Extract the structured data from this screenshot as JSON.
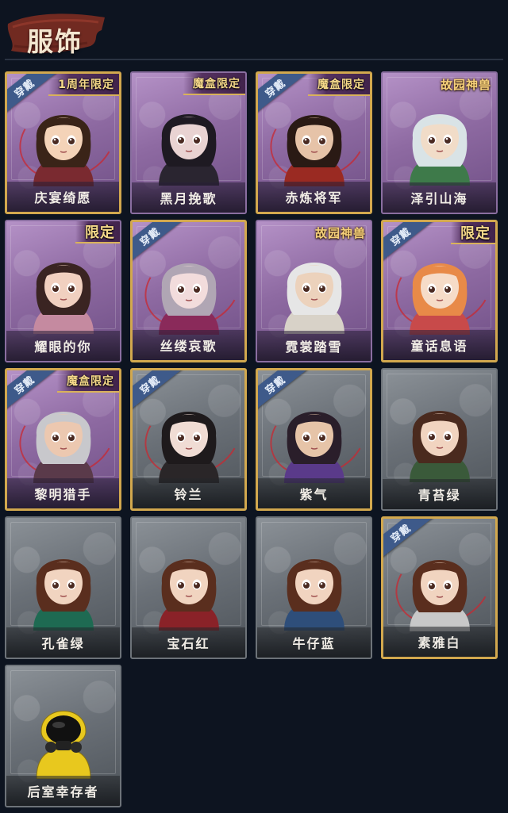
{
  "header": {
    "title": "服饰"
  },
  "worn_label": "穿戴",
  "costumes": [
    {
      "name": "庆宴绮愿",
      "tag": "1周年限定",
      "tag_style": "plain",
      "worn": true,
      "rarity": "rare",
      "hair": "#3a2418",
      "skin": "#f4d3b8",
      "outfit": "#7a2a30"
    },
    {
      "name": "黑月挽歌",
      "tag": "魔盒限定",
      "tag_style": "plain",
      "worn": false,
      "rarity": "rare",
      "hair": "#1e1a22",
      "skin": "#e9d3d2",
      "outfit": "#2a2530"
    },
    {
      "name": "赤炼将军",
      "tag": "魔盒限定",
      "tag_style": "plain",
      "worn": true,
      "rarity": "rare",
      "hair": "#2a1a14",
      "skin": "#e6c3a8",
      "outfit": "#9a2a22"
    },
    {
      "name": "泽引山海",
      "tag": "故园神兽",
      "tag_style": "gold",
      "worn": false,
      "rarity": "rare",
      "hair": "#d9e3e6",
      "skin": "#f1dcc8",
      "outfit": "#3e7a4a"
    },
    {
      "name": "耀眼的你",
      "tag": "限定",
      "tag_style": "big",
      "worn": false,
      "rarity": "rare",
      "hair": "#3a2422",
      "skin": "#f1d0c0",
      "outfit": "#c58aa0"
    },
    {
      "name": "丝缕哀歌",
      "tag": "",
      "tag_style": "none",
      "worn": true,
      "rarity": "rare",
      "hair": "#b0a6b4",
      "skin": "#f2dcdc",
      "outfit": "#8a2a5a"
    },
    {
      "name": "霓裳踏雪",
      "tag": "故园神兽",
      "tag_style": "gold",
      "worn": false,
      "rarity": "rare",
      "hair": "#e6e6e6",
      "skin": "#ecd2bc",
      "outfit": "#d8d2c8"
    },
    {
      "name": "童话息语",
      "tag": "限定",
      "tag_style": "big",
      "worn": true,
      "rarity": "rare",
      "hair": "#e88a48",
      "skin": "#f6dcc8",
      "outfit": "#c84a4a"
    },
    {
      "name": "黎明猎手",
      "tag": "魔盒限定",
      "tag_style": "plain",
      "worn": true,
      "rarity": "rare",
      "hair": "#c8c8cc",
      "skin": "#ecc8b0",
      "outfit": "#5a3a4a"
    },
    {
      "name": "铃兰",
      "tag": "",
      "tag_style": "none",
      "worn": true,
      "rarity": "common",
      "hair": "#1e1a1c",
      "skin": "#f0dcd4",
      "outfit": "#2a2628"
    },
    {
      "name": "紫气",
      "tag": "",
      "tag_style": "none",
      "worn": true,
      "rarity": "common",
      "hair": "#2a1e2a",
      "skin": "#e6c4a8",
      "outfit": "#5a3a8a"
    },
    {
      "name": "青苔绿",
      "tag": "",
      "tag_style": "none",
      "worn": false,
      "rarity": "common",
      "hair": "#4a2a1e",
      "skin": "#f1d4c0",
      "outfit": "#3a5a3a"
    },
    {
      "name": "孔雀绿",
      "tag": "",
      "tag_style": "none",
      "worn": false,
      "rarity": "common",
      "hair": "#5a2e1e",
      "skin": "#f1d4c0",
      "outfit": "#1e6a52"
    },
    {
      "name": "宝石红",
      "tag": "",
      "tag_style": "none",
      "worn": false,
      "rarity": "common",
      "hair": "#5a2e1e",
      "skin": "#f1d4c0",
      "outfit": "#8a2228"
    },
    {
      "name": "牛仔蓝",
      "tag": "",
      "tag_style": "none",
      "worn": false,
      "rarity": "common",
      "hair": "#5a2e1e",
      "skin": "#f1d4c0",
      "outfit": "#2e4e7a"
    },
    {
      "name": "素雅白",
      "tag": "",
      "tag_style": "none",
      "worn": true,
      "rarity": "common",
      "hair": "#5a2e1e",
      "skin": "#f1d4c0",
      "outfit": "#c8c8c8"
    },
    {
      "name": "后室幸存者",
      "tag": "",
      "tag_style": "none",
      "worn": false,
      "rarity": "common",
      "hair": "#1a1a1a",
      "skin": "#2a2a2a",
      "outfit": "#e8c81e",
      "hazmat": true
    }
  ]
}
